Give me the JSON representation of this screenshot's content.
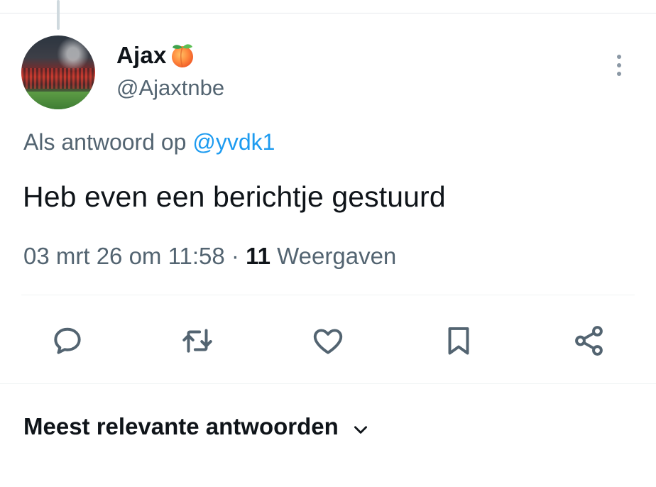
{
  "tweet": {
    "author": {
      "display_name": "Ajax",
      "name_emoji": "peach",
      "handle": "@Ajaxtnbe"
    },
    "reply_context": {
      "prefix": "Als antwoord op",
      "mention": "@yvdk1"
    },
    "text": "Heb even een berichtje gestuurd",
    "timestamp": "03 mrt 26 om 11:58",
    "separator": "·",
    "views_count": "11",
    "views_label": "Weergaven"
  },
  "actions": {
    "icons": [
      "reply-icon",
      "retweet-icon",
      "like-icon",
      "bookmark-icon",
      "share-icon"
    ]
  },
  "replies": {
    "sort_label": "Meest relevante antwoorden"
  },
  "colors": {
    "text_primary": "#0f1419",
    "text_secondary": "#536471",
    "accent": "#1d9bf0",
    "divider": "#eff3f4"
  }
}
